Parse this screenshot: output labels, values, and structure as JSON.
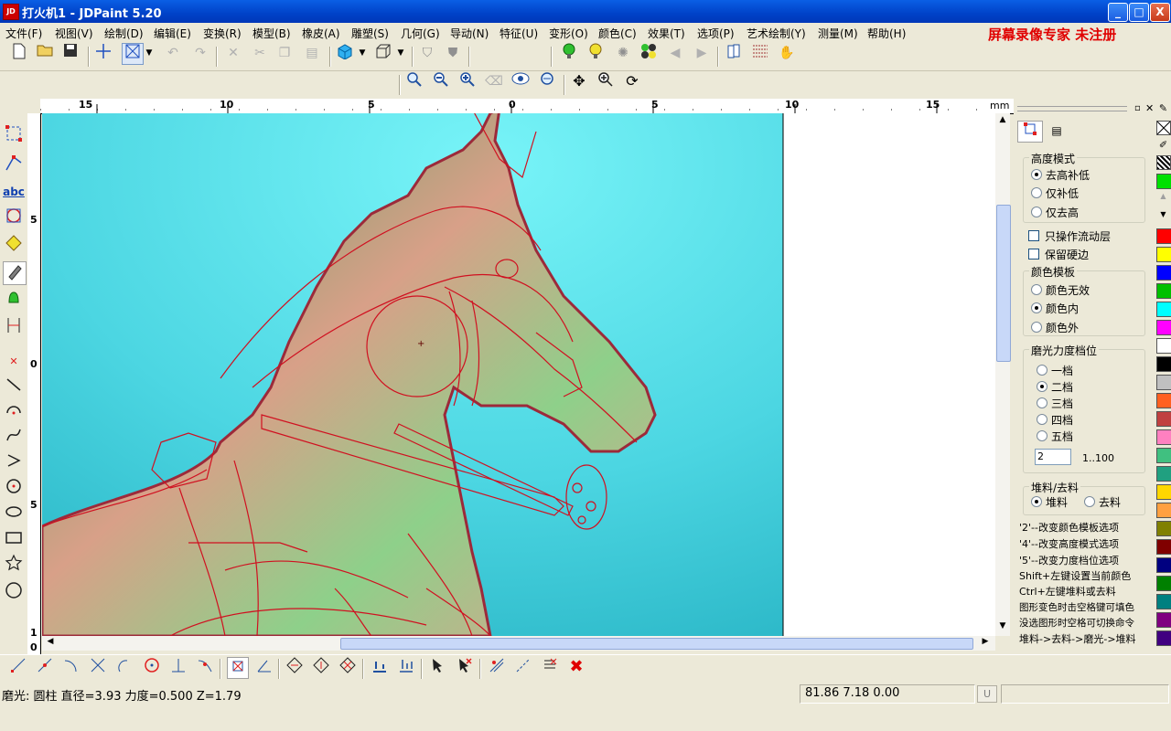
{
  "app": {
    "icon": "JD",
    "title": "打火机1 - JDPaint 5.20"
  },
  "window_buttons": {
    "minimize": "_",
    "maximize": "□",
    "close": "X"
  },
  "menu": {
    "items": [
      "文件(F)",
      "视图(V)",
      "绘制(D)",
      "编辑(E)",
      "变换(R)",
      "模型(B)",
      "橡皮(A)",
      "雕塑(S)",
      "几何(G)",
      "导动(N)",
      "特征(U)",
      "变形(O)",
      "颜色(C)",
      "效果(T)",
      "选项(P)",
      "艺术绘制(Y)",
      "测量(M)",
      "帮助(H)"
    ],
    "registration": "屏幕录像专家 未注册"
  },
  "ruler": {
    "unit": "mm",
    "top_labels": [
      "15",
      "10",
      "5",
      "0",
      "5",
      "10",
      "15"
    ],
    "left_labels": [
      "5",
      "0",
      "5",
      "1",
      "0"
    ]
  },
  "panel": {
    "height_mode": {
      "title": "高度模式",
      "options": [
        "去高补低",
        "仅补低",
        "仅去高"
      ],
      "selected": 0
    },
    "only_flow_layer": "只操作流动层",
    "keep_hard_edge": "保留硬边",
    "color_template": {
      "title": "颜色模板",
      "options": [
        "颜色无效",
        "颜色内",
        "颜色外"
      ],
      "selected": 1
    },
    "polish_level": {
      "title": "磨光力度档位",
      "options": [
        "一档",
        "二档",
        "三档",
        "四档",
        "五档"
      ],
      "selected": 1,
      "value": "2",
      "range": "1..100"
    },
    "stock": {
      "title": "堆料/去料",
      "options": [
        "堆料",
        "去料"
      ],
      "selected": 0
    },
    "hints": [
      "'2'--改变颜色模板选项",
      "'4'--改变高度模式选项",
      "'5'--改变力度档位选项",
      "Shift+左键设置当前颜色",
      "Ctrl+左键堆料或去料",
      "图形变色时击空格键可填色",
      "没选图形时空格可切换命令",
      "堆料->去料->磨光->堆料"
    ]
  },
  "palette": [
    "#FF0000",
    "#FFFF00",
    "#0000FF",
    "#00C000",
    "#00FFFF",
    "#FF00FF",
    "#FFFFFF",
    "#000000",
    "#C0C0C0",
    "#FF6020",
    "#C04040",
    "#FF80C0",
    "#40C080",
    "#20A080",
    "#FFD700",
    "#FFA040",
    "#808000",
    "#800000",
    "#000080",
    "#008000",
    "#008080",
    "#800080",
    "#400080"
  ],
  "palette_top": [
    "#00E000",
    "#00E000"
  ],
  "status": {
    "text": "磨光: 圆柱  直径=3.93  力度=0.500  Z=1.79",
    "coords": "81.86 7.18 0.00",
    "mode": "U"
  },
  "icons": {
    "toolbar": [
      "new-file-icon",
      "open-folder-icon",
      "save-icon",
      "crosshair-icon",
      "select-box-icon",
      "undo-icon",
      "redo-icon",
      "delete-icon",
      "cut-icon",
      "copy-icon",
      "paste-icon",
      "color-cube-icon",
      "view-3d-icon",
      "shield-icon",
      "lightbulb-icon"
    ],
    "toolbar2": [
      "zoom-window-icon",
      "zoom-out-icon",
      "zoom-in-icon",
      "eraser-icon",
      "eye-icon",
      "zoom-fit-icon",
      "pan-icon",
      "zoom-icon",
      "refresh-icon"
    ]
  }
}
